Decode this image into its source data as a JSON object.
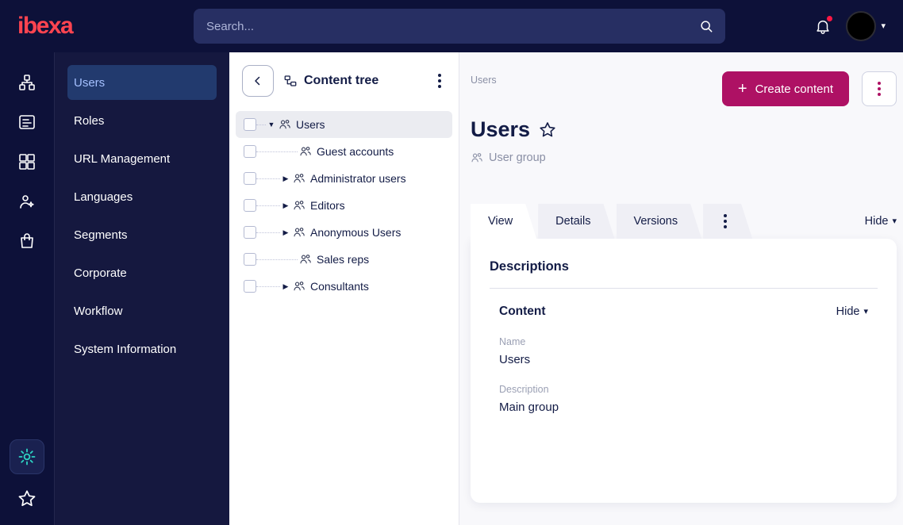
{
  "topbar": {
    "logo_text": "ibexa",
    "search_placeholder": "Search..."
  },
  "glyphs": {
    "plus": "+",
    "caret_down": "▾",
    "tree_expanded": "▼",
    "tree_collapsed": "▶"
  },
  "rail": {
    "icons": [
      "content-structure",
      "content-list",
      "blocks",
      "personalization",
      "commerce",
      "settings",
      "bookmarks"
    ],
    "active_icon": "none"
  },
  "sidebar": {
    "items": [
      {
        "label": "Users",
        "active": true
      },
      {
        "label": "Roles",
        "active": false
      },
      {
        "label": "URL Management",
        "active": false
      },
      {
        "label": "Languages",
        "active": false
      },
      {
        "label": "Segments",
        "active": false
      },
      {
        "label": "Corporate",
        "active": false
      },
      {
        "label": "Workflow",
        "active": false
      },
      {
        "label": "System Information",
        "active": false
      }
    ]
  },
  "content_tree": {
    "title": "Content tree",
    "items": [
      {
        "label": "Users",
        "level": 0,
        "expanded": true,
        "selected": true
      },
      {
        "label": "Guest accounts",
        "level": 1,
        "leaf": true,
        "selected": false
      },
      {
        "label": "Administrator users",
        "level": 1,
        "collapsed": true,
        "selected": false
      },
      {
        "label": "Editors",
        "level": 1,
        "collapsed": true,
        "selected": false
      },
      {
        "label": "Anonymous Users",
        "level": 1,
        "collapsed": true,
        "selected": false
      },
      {
        "label": "Sales reps",
        "level": 1,
        "leaf": true,
        "selected": false
      },
      {
        "label": "Consultants",
        "level": 1,
        "collapsed": true,
        "selected": false
      }
    ]
  },
  "main": {
    "breadcrumb": "Users",
    "create_button_label": "Create content",
    "page_title": "Users",
    "content_type": "User group",
    "tabs": [
      {
        "label": "View",
        "active": true
      },
      {
        "label": "Details",
        "active": false
      },
      {
        "label": "Versions",
        "active": false
      }
    ],
    "hide_toggle_label": "Hide",
    "view": {
      "section_title": "Descriptions",
      "group_title": "Content",
      "group_hide_label": "Hide",
      "fields": [
        {
          "label": "Name",
          "value": "Users"
        },
        {
          "label": "Description",
          "value": "Main group"
        }
      ]
    }
  },
  "colors": {
    "primary_magenta": "#ae1164",
    "dark_navy": "#0d1139",
    "sidebar_navy": "#15183f",
    "active_item_blue": "#223a6e",
    "accent_teal": "#2dd5c4",
    "logo_red": "#ff4450"
  }
}
